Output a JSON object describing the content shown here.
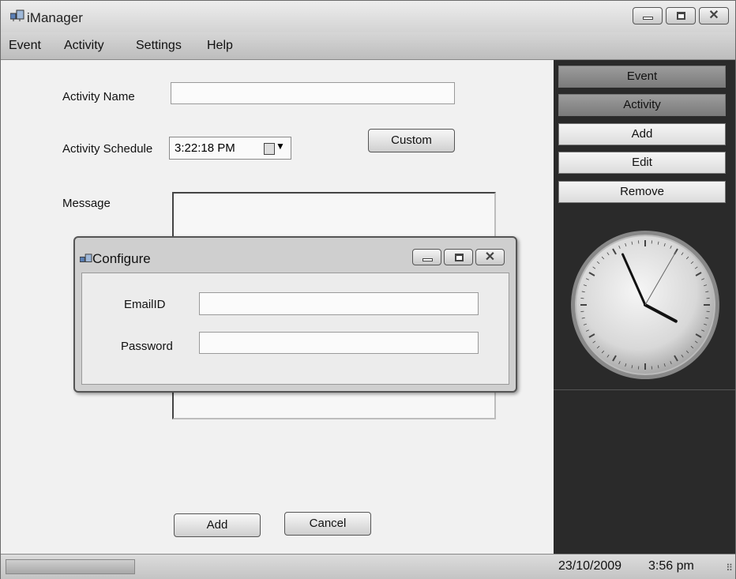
{
  "window": {
    "title": "iManager"
  },
  "menu": [
    "Event",
    "Activity",
    "Settings",
    "Help"
  ],
  "form": {
    "activity_name_label": "Activity Name",
    "activity_name_value": "",
    "schedule_label": "Activity Schedule",
    "schedule_value": "3:22:18 PM",
    "custom_button": "Custom",
    "message_label": "Message",
    "message_value": "",
    "add_button": "Add",
    "cancel_button": "Cancel"
  },
  "dialog": {
    "title": "Configure",
    "email_label": "EmailID",
    "email_value": "",
    "password_label": "Password",
    "password_value": ""
  },
  "sidebar": {
    "buttons": [
      "Event",
      "Activity",
      "Add",
      "Edit",
      "Remove"
    ]
  },
  "clock": {
    "hour": 3,
    "minute": 56,
    "second": 5
  },
  "status": {
    "date": "23/10/2009",
    "time": "3:56 pm",
    "progress": 1.0
  },
  "icons": {
    "app": "app-window-icon",
    "calendar": "calendar-icon",
    "dropdown": "chevron-down-icon"
  }
}
